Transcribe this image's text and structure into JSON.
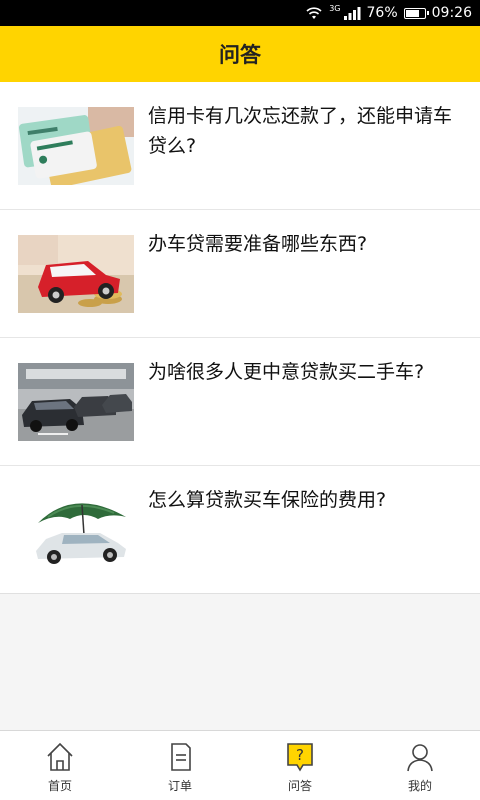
{
  "status_bar": {
    "network": "3G",
    "battery": "76%",
    "time": "09:26"
  },
  "header": {
    "title": "问答"
  },
  "questions": [
    {
      "title": "信用卡有几次忘还款了，还能申请车贷么?",
      "thumb_icon": "credit-cards-image"
    },
    {
      "title": "办车贷需要准备哪些东西?",
      "thumb_icon": "red-car-on-money-image"
    },
    {
      "title": "为啥很多人更中意贷款买二手车?",
      "thumb_icon": "parked-cars-image"
    },
    {
      "title": "怎么算贷款买车保险的费用?",
      "thumb_icon": "car-under-umbrella-image"
    }
  ],
  "bottom_nav": {
    "items": [
      {
        "label": "首页",
        "icon": "home-icon"
      },
      {
        "label": "订单",
        "icon": "order-icon"
      },
      {
        "label": "问答",
        "icon": "question-icon",
        "active": true
      },
      {
        "label": "我的",
        "icon": "person-icon"
      }
    ]
  },
  "colors": {
    "accent": "#ffd400",
    "status_bar": "#000000"
  }
}
